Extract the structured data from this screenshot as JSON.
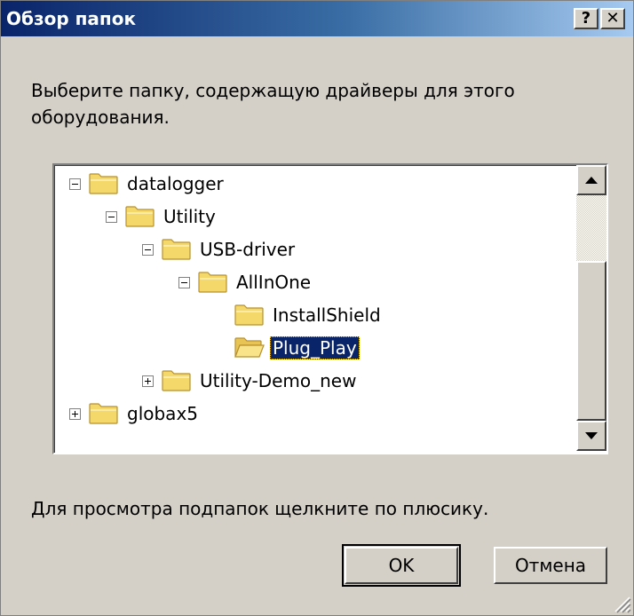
{
  "window": {
    "title": "Обзор папок"
  },
  "titlebar": {
    "help_label": "?",
    "close_label": "✕"
  },
  "instruction": "Выберите папку, содержащую драйверы для этого оборудования.",
  "tree": {
    "items": [
      {
        "label": "datalogger",
        "level": 0,
        "expander": "minus",
        "selected": false
      },
      {
        "label": "Utility",
        "level": 1,
        "expander": "minus",
        "selected": false
      },
      {
        "label": "USB-driver",
        "level": 2,
        "expander": "minus",
        "selected": false
      },
      {
        "label": "AllInOne",
        "level": 3,
        "expander": "minus",
        "selected": false
      },
      {
        "label": "InstallShield",
        "level": 4,
        "expander": "none",
        "selected": false
      },
      {
        "label": "Plug_Play",
        "level": 4,
        "expander": "none",
        "selected": true
      },
      {
        "label": "Utility-Demo_new",
        "level": 2,
        "expander": "plus",
        "selected": false
      },
      {
        "label": "globax5",
        "level": 0,
        "expander": "plus",
        "selected": false
      }
    ],
    "icons": {
      "folder": "folder-icon",
      "folder_open": "folder-open-icon",
      "expand": "plus-box-icon",
      "collapse": "minus-box-icon"
    }
  },
  "hint": "Для просмотра подпапок щелкните по плюсику.",
  "buttons": {
    "ok_label": "OK",
    "cancel_label": "Отмена"
  },
  "colors": {
    "title_start": "#0a246a",
    "title_end": "#a6caf0",
    "selection": "#0a246a",
    "face": "#d4d0c8",
    "folder": "#f5d86a"
  }
}
